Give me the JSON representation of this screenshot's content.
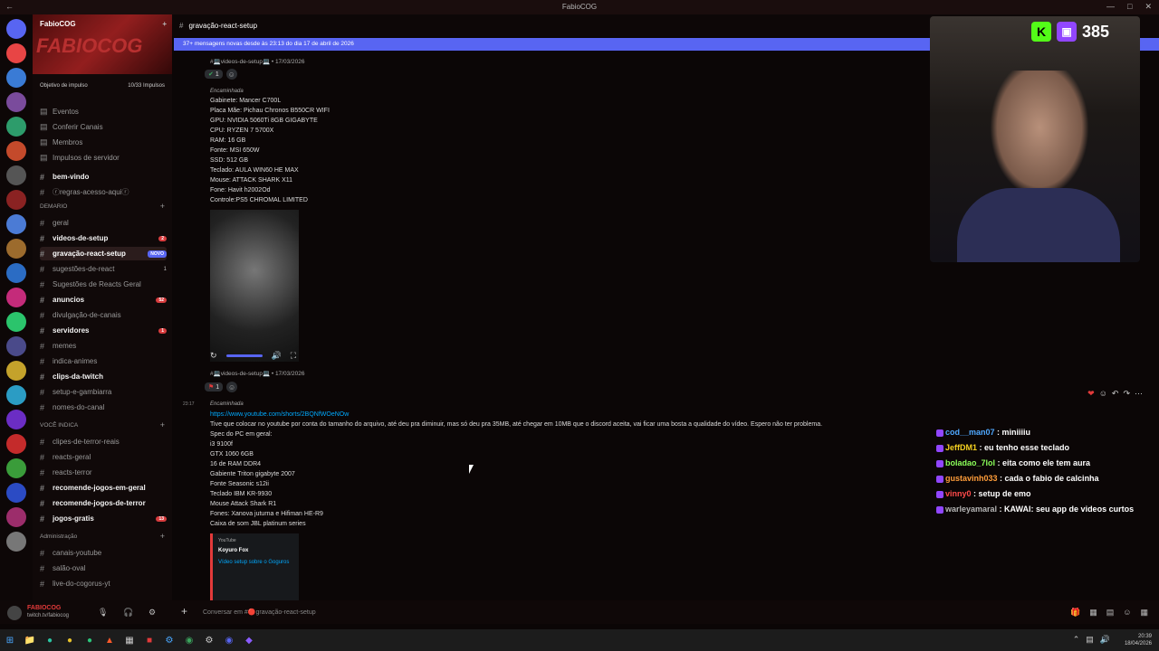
{
  "window": {
    "title": "FabioCOG"
  },
  "server": {
    "name": "FabioCOG",
    "boost_label": "Objetivo de impulso",
    "boost_count": "10/33 Impulsos",
    "banner_text": "FABIOCOG"
  },
  "nav": [
    {
      "label": "Eventos",
      "icon": "calendar-icon"
    },
    {
      "label": "Conferir Canais",
      "icon": "channels-icon"
    },
    {
      "label": "Membros",
      "icon": "members-icon"
    },
    {
      "label": "Impulsos de servidor",
      "icon": "boost-icon"
    }
  ],
  "channels_top": [
    {
      "label": "bem-vindo"
    },
    {
      "label": "ⓡregras-acesso-aquiⓡ"
    }
  ],
  "category_demario": "DEMARIO",
  "channels_demario": [
    {
      "label": "geral"
    },
    {
      "label": "videos-de-setup",
      "badge": "2"
    },
    {
      "label": "gravação-react-setup",
      "tag": "NOVO"
    },
    {
      "label": "sugestões-de-react",
      "count": "1"
    },
    {
      "label": "Sugestões de Reacts Geral"
    },
    {
      "label": "anuncios",
      "badge": "52"
    },
    {
      "label": "divulgação-de-canais"
    },
    {
      "label": "servidores",
      "badge": "1"
    },
    {
      "label": "memes"
    },
    {
      "label": "indica-animes"
    },
    {
      "label": "clips-da-twitch"
    },
    {
      "label": "setup-e-gambiarra"
    },
    {
      "label": "nomes-do-canal"
    }
  ],
  "category_indica": "VOCÊ INDICA",
  "channels_indica": [
    {
      "label": "clipes-de-terror-reais"
    },
    {
      "label": "reacts-geral"
    },
    {
      "label": "reacts-terror"
    },
    {
      "label": "recomende-jogos-em-geral"
    },
    {
      "label": "recomende-jogos-de-terror"
    },
    {
      "label": "jogos-gratis",
      "badge": "13"
    }
  ],
  "category_admin": "Administração",
  "channels_admin": [
    {
      "label": "canais-youtube"
    },
    {
      "label": "salão-oval"
    },
    {
      "label": "live-do-cogorus-yt"
    }
  ],
  "user": {
    "name": "FABIOCOG",
    "status": "twitch.tv/fabiocog"
  },
  "chat": {
    "channel": "gravação-react-setup",
    "new_messages": "37+ mensagens novas desde às 23:13 do dia 17 de abril de 2026",
    "msg1_meta": "#💻videos-de-setup💻 • 17/03/2026",
    "reaction_count": "1",
    "forwarded": "Encaminhada",
    "msg1_lines": [
      "Gabinete: Mancer C700L",
      "Placa Mãe: Pichau Chronos B550CR WIFI",
      "GPU: NVIDIA 5060Ti 8GB GIGABYTE",
      "CPU: RYZEN 7 5700X",
      "RAM: 16 GB",
      "Fonte: MSI 650W",
      "SSD: 512 GB",
      "Teclado: AULA WIN60 HE MAX",
      "Mouse: ATTACK SHARK X11",
      "Fone: Havit h2002Od",
      "Controle:PS5 CHROMAL LIMITED"
    ],
    "msg2_meta": "#💻videos-de-setup💻 • 17/03/2026",
    "msg3_time": "23:17",
    "msg3_link": "https://www.youtube.com/shorts/2BQNfWOeNOw",
    "msg3_lines": [
      "Tive que colocar no youtube por conta do tamanho do arquivo, até deu pra diminuir, mas só deu pra 35MB, até chegar em 10MB que o discord aceita, vai ficar uma bosta a qualidade do vídeo. Espero não ter problema.",
      "Spec do PC em geral:",
      "i3 9100f",
      "GTX 1060 6GB",
      "16 de RAM DDR4",
      "Gabiente Triton gigabyte 2007",
      "Fonte Seasonic s12ii",
      "Teclado IBM KR-9930",
      "Mouse Attack Shark R1",
      "Fones: Xanova juturna e Hifiman HE-R9",
      "Caixa de som JBL platinum series"
    ],
    "embed": {
      "provider": "YouTube",
      "author": "Koyuro Fox",
      "title": "Vídeo setup sobre o Goguros"
    },
    "input_placeholder": "Conversar em #🔴gravação-react-setup"
  },
  "stream": {
    "viewers": "385"
  },
  "twitch_chat": [
    {
      "user": "cod__man07",
      "color": "#4fa8ff",
      "text": "miniiiiu"
    },
    {
      "user": "JeffDM1",
      "color": "#f5d020",
      "text": "eu tenho esse teclado"
    },
    {
      "user": "boladao_7lol",
      "color": "#8bff5a",
      "text": "eita como ele tem aura"
    },
    {
      "user": "gustavinh033",
      "color": "#ff9d3a",
      "text": "cada o fabio de calcinha"
    },
    {
      "user": "vinny0",
      "color": "#ff4a4a",
      "text": "setup de emo"
    },
    {
      "user": "warleyamaral",
      "color": "#b5b5b5",
      "text": "KAWAI: seu app de videos curtos"
    }
  ],
  "clock": {
    "time": "20:39",
    "date": "18/04/2026"
  }
}
